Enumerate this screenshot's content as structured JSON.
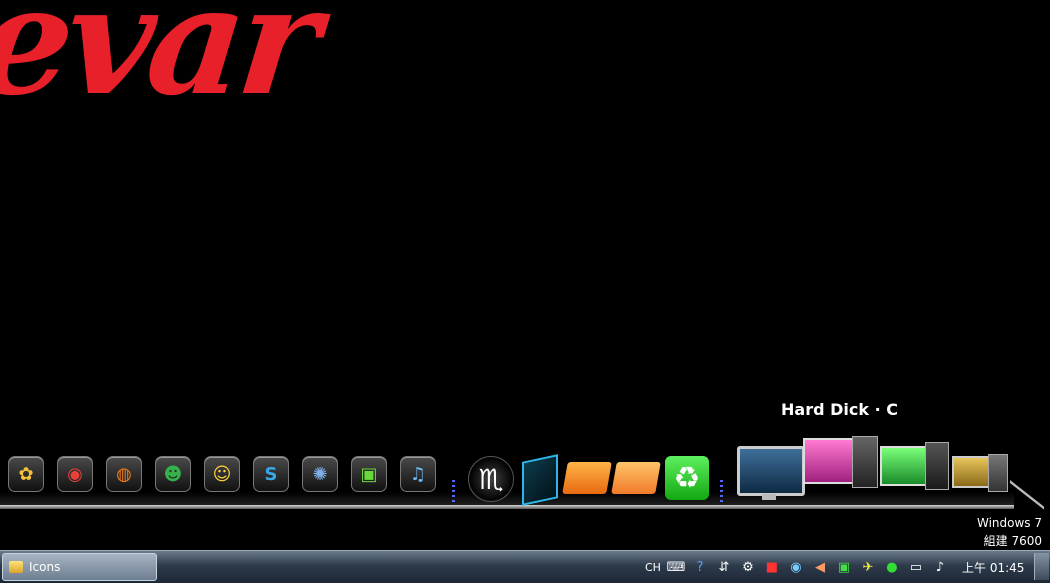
{
  "wallpaper": {
    "text": "evar",
    "color": "#e8202a"
  },
  "dock": {
    "hover_label": "Hard Dick · C",
    "small_icons": [
      {
        "name": "pidgin-icon",
        "glyph": "✿",
        "color": "#f5c23a"
      },
      {
        "name": "chrome-icon",
        "glyph": "◉",
        "color": "#e8403a"
      },
      {
        "name": "firefox-icon",
        "glyph": "◍",
        "color": "#f07d1f"
      },
      {
        "name": "msn-messenger-icon",
        "glyph": "☻",
        "color": "#36b24a"
      },
      {
        "name": "yahoo-messenger-icon",
        "glyph": "☺",
        "color": "#ffd23a"
      },
      {
        "name": "skype-icon",
        "glyph": "S",
        "color": "#39a8e8"
      },
      {
        "name": "network-globe-icon",
        "glyph": "✺",
        "color": "#7fb0e8"
      },
      {
        "name": "windows-live-icon",
        "glyph": "▣",
        "color": "#6ad83a"
      },
      {
        "name": "itunes-icon",
        "glyph": "♫",
        "color": "#6fb8f0"
      }
    ],
    "large_icons": [
      {
        "name": "scorpio-icon",
        "glyph": "♏"
      },
      {
        "name": "screen-glass-icon",
        "glyph": ""
      },
      {
        "name": "documents-folder-icon",
        "glyph": ""
      },
      {
        "name": "pictures-folder-icon",
        "glyph": ""
      },
      {
        "name": "recycle-bin-icon",
        "glyph": "♻"
      },
      {
        "name": "monitor-icon",
        "glyph": ""
      },
      {
        "name": "computer-pink-icon",
        "glyph": ""
      },
      {
        "name": "computer-green-icon",
        "glyph": ""
      },
      {
        "name": "computer-gold-icon",
        "glyph": ""
      }
    ]
  },
  "watermark": {
    "line1": "Windows 7",
    "line2": "組建 7600"
  },
  "taskbar": {
    "task_button_label": "Icons",
    "tray": {
      "language": "CH",
      "icons": [
        "keyboard-icon",
        "help-icon",
        "network-up-icon",
        "steam-icon",
        "red-app-icon",
        "globe-icon",
        "speaker-icon",
        "chat-icon",
        "airplane-icon",
        "green-circle-icon",
        "monitor-network-icon",
        "volume-icon"
      ]
    },
    "clock": "上午 01:45"
  }
}
